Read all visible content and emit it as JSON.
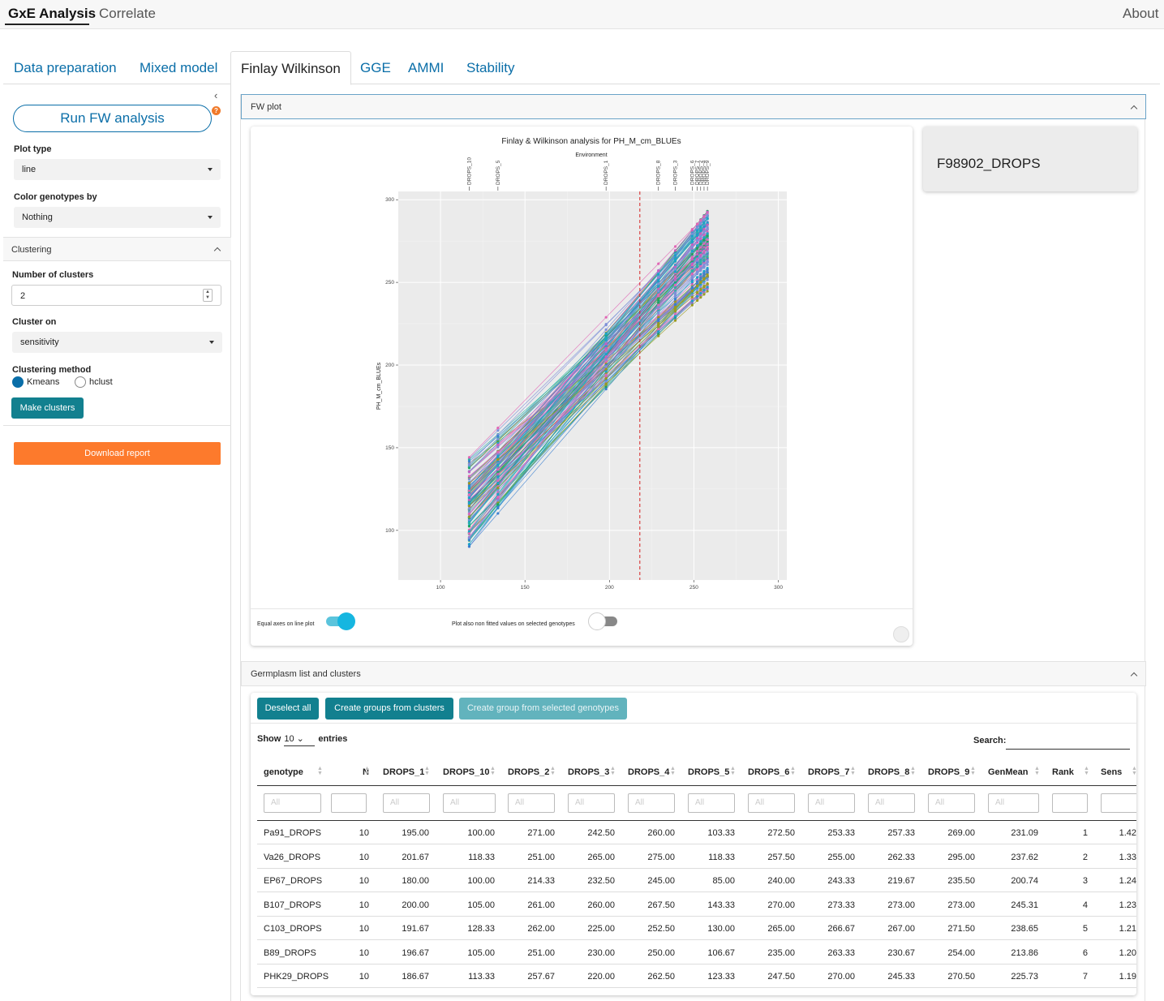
{
  "topnav": {
    "tabs": [
      "GxE Analysis",
      "Correlate"
    ],
    "active": "GxE Analysis",
    "about": "About"
  },
  "subtabs": [
    "Data preparation",
    "Mixed model",
    "Finlay Wilkinson",
    "GGE",
    "AMMI",
    "Stability"
  ],
  "active_subtab": "Finlay Wilkinson",
  "sidebar": {
    "run_button": "Run FW analysis",
    "help_badge": "?",
    "plot_type_label": "Plot type",
    "plot_type_value": "line",
    "color_label": "Color genotypes by",
    "color_value": "Nothing",
    "clustering_header": "Clustering",
    "num_clusters_label": "Number of clusters",
    "num_clusters_value": "2",
    "cluster_on_label": "Cluster on",
    "cluster_on_value": "sensitivity",
    "method_label": "Clustering method",
    "method_options": [
      "Kmeans",
      "hclust"
    ],
    "method_selected": "Kmeans",
    "make_clusters": "Make clusters",
    "download": "Download report"
  },
  "fw_panel": {
    "header": "FW plot",
    "selected_genotype": "F98902_DROPS",
    "switch1_label": "Equal axes on line plot",
    "switch1_on": true,
    "switch2_label": "Plot also non fitted values on selected genotypes",
    "switch2_on": false
  },
  "chart_data": {
    "type": "line",
    "title": "Finlay & Wilkinson analysis for PH_M_cm_BLUEs",
    "top_axis_label": "Environment",
    "ylabel": "PH_M_cm_BLUEs",
    "xlabel": "",
    "xlim": [
      75,
      305
    ],
    "ylim": [
      70,
      305
    ],
    "x_ticks": [
      100,
      150,
      200,
      250,
      300
    ],
    "y_ticks": [
      100,
      150,
      200,
      250,
      300
    ],
    "grid": true,
    "legend": "none",
    "environments": [
      {
        "name": "DROPS_10",
        "mean": 117
      },
      {
        "name": "DROPS_5",
        "mean": 134
      },
      {
        "name": "DROPS_1",
        "mean": 198
      },
      {
        "name": "DROPS_8",
        "mean": 229
      },
      {
        "name": "DROPS_3",
        "mean": 239
      },
      {
        "name": "DROPS_6",
        "mean": 249
      },
      {
        "name": "DROPS_7",
        "mean": 252
      },
      {
        "name": "DROPS_2",
        "mean": 254
      },
      {
        "name": "DROPS_4",
        "mean": 256
      },
      {
        "name": "DROPS_9",
        "mean": 258
      }
    ],
    "reference_line_x": 218,
    "series_summary": {
      "count": 120,
      "y_at_x117_range": [
        75,
        142
      ],
      "y_at_x258_range": [
        218,
        294
      ]
    },
    "palette": [
      "#1aa3c8",
      "#e067b5",
      "#3a7fd0",
      "#9a9a20",
      "#1fa45e",
      "#7f8fd8",
      "#c65fbf",
      "#2cb3a3"
    ]
  },
  "table_panel": {
    "header": "Germplasm list and clusters",
    "buttons": [
      "Deselect all",
      "Create groups from clusters",
      "Create group from selected genotypes"
    ],
    "show": "Show",
    "entries_value": "10",
    "entries": "entries",
    "search": "Search:",
    "filter_placeholder": "All",
    "columns": [
      "genotype",
      "N",
      "DROPS_1",
      "DROPS_10",
      "DROPS_2",
      "DROPS_3",
      "DROPS_4",
      "DROPS_5",
      "DROPS_6",
      "DROPS_7",
      "DROPS_8",
      "DROPS_9",
      "GenMean",
      "Rank",
      "Sens"
    ],
    "rows": [
      [
        "Pa91_DROPS",
        "10",
        "195.00",
        "100.00",
        "271.00",
        "242.50",
        "260.00",
        "103.33",
        "272.50",
        "253.33",
        "257.33",
        "269.00",
        "231.09",
        "1",
        "1.42"
      ],
      [
        "Va26_DROPS",
        "10",
        "201.67",
        "118.33",
        "251.00",
        "265.00",
        "275.00",
        "118.33",
        "257.50",
        "255.00",
        "262.33",
        "295.00",
        "237.62",
        "2",
        "1.33"
      ],
      [
        "EP67_DROPS",
        "10",
        "180.00",
        "100.00",
        "214.33",
        "232.50",
        "245.00",
        "85.00",
        "240.00",
        "243.33",
        "219.67",
        "235.50",
        "200.74",
        "3",
        "1.24"
      ],
      [
        "B107_DROPS",
        "10",
        "200.00",
        "105.00",
        "261.00",
        "260.00",
        "267.50",
        "143.33",
        "270.00",
        "273.33",
        "273.00",
        "273.00",
        "245.31",
        "4",
        "1.23"
      ],
      [
        "C103_DROPS",
        "10",
        "191.67",
        "128.33",
        "262.00",
        "225.00",
        "252.50",
        "130.00",
        "265.00",
        "266.67",
        "267.00",
        "271.50",
        "238.65",
        "5",
        "1.21"
      ],
      [
        "B89_DROPS",
        "10",
        "196.67",
        "105.00",
        "251.00",
        "230.00",
        "250.00",
        "106.67",
        "235.00",
        "263.33",
        "230.67",
        "254.00",
        "213.86",
        "6",
        "1.20"
      ],
      [
        "PHK29_DROPS",
        "10",
        "186.67",
        "113.33",
        "257.67",
        "220.00",
        "262.50",
        "123.33",
        "247.50",
        "270.00",
        "245.33",
        "270.50",
        "225.73",
        "7",
        "1.19"
      ]
    ]
  }
}
